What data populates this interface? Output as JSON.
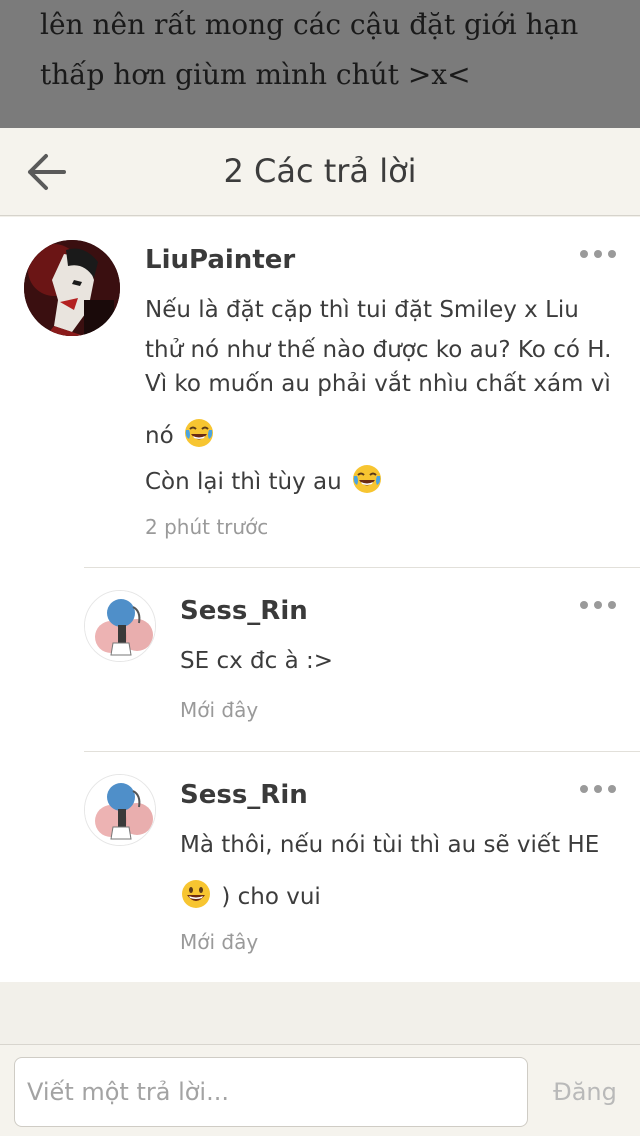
{
  "story": {
    "line1": "lên nên rất mong các cậu đặt giới hạn",
    "line2": "thấp hơn giùm mình chút >x<"
  },
  "header": {
    "title": "2 Các trả lời"
  },
  "comments": [
    {
      "username": "LiuPainter",
      "lines": [
        "Nếu là đặt cặp thì tui đặt Smiley x Liu",
        "thử nó như thế nào được ko au? Ko có H.",
        "Vì ko muốn au phải vắt nhìu chất xám vì",
        "nó",
        "Còn lại thì tùy au"
      ],
      "time": "2 phút trước"
    },
    {
      "username": "Sess_Rin",
      "lines": [
        "SE cx đc à :>"
      ],
      "time": "Mới đây"
    },
    {
      "username": "Sess_Rin",
      "lines": [
        "Mà thôi, nếu nói tùi thì au sẽ viết HE",
        ") cho vui"
      ],
      "time": "Mới đây"
    }
  ],
  "reply": {
    "placeholder": "Viết một trả lời...",
    "post_label": "Đăng"
  },
  "icons": {
    "back": "arrow-left",
    "more": "three-dots",
    "laugh_emoji": "face-with-tears-of-joy",
    "grin_emoji": "grinning-face"
  },
  "colors": {
    "story_bg": "#7b7b7b",
    "header_bg": "#f5f3ed",
    "list_bg": "#ffffff",
    "text": "#3c3c3c",
    "muted": "#9a9a9a",
    "post_disabled": "#b9b9b9"
  }
}
